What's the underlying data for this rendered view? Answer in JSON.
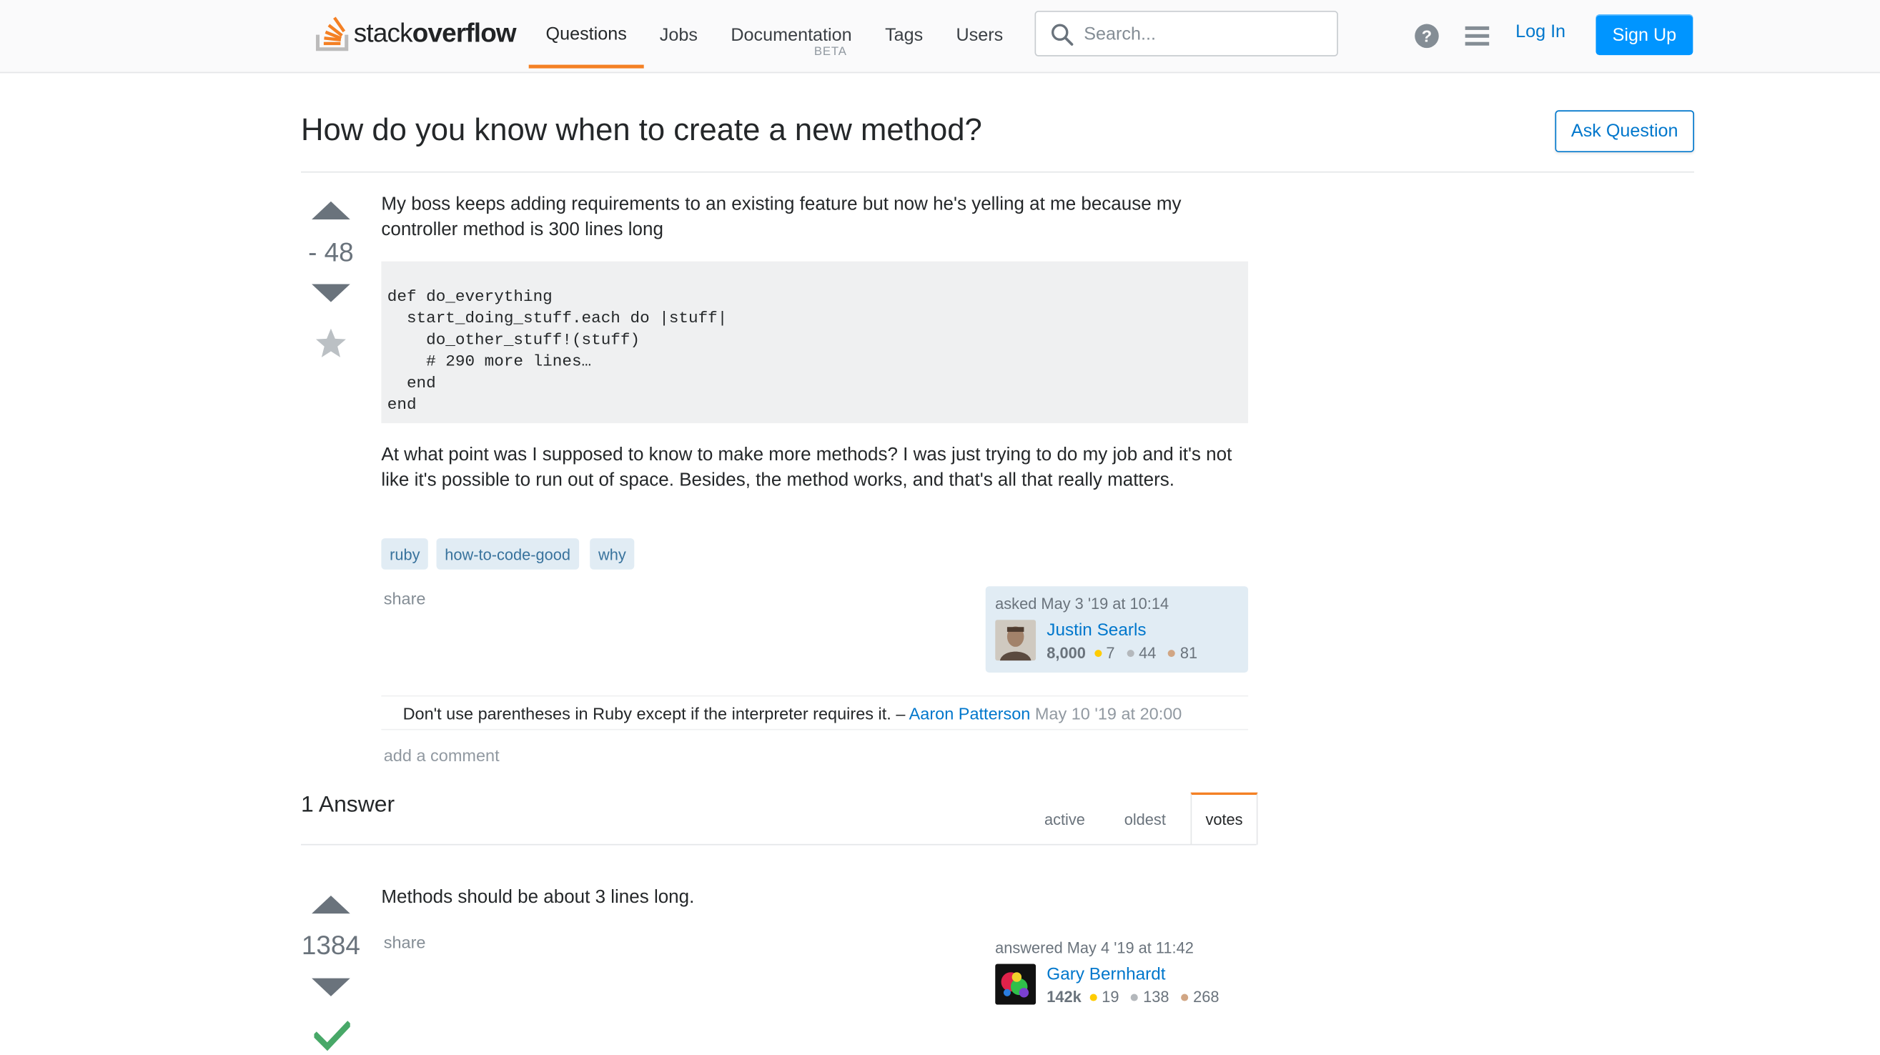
{
  "header": {
    "logo": {
      "light": "stack",
      "bold": "overflow"
    },
    "nav": [
      {
        "label": "Questions",
        "active": true
      },
      {
        "label": "Jobs",
        "active": false
      },
      {
        "label": "Documentation",
        "badge": "BETA",
        "active": false
      },
      {
        "label": "Tags",
        "active": false
      },
      {
        "label": "Users",
        "active": false
      }
    ],
    "search_placeholder": "Search...",
    "help_icon": "question-circle-icon",
    "menu_icon": "hamburger-menu-icon",
    "login_label": "Log In",
    "signup_label": "Sign Up",
    "accent_color": "#f48024",
    "primary_color": "#0095ff"
  },
  "question": {
    "title": "How do you know when to create a new method?",
    "ask_button": "Ask Question",
    "votes": "- 48",
    "intro": "My boss keeps adding requirements to an existing feature but now he's yelling at me because my controller method is 300 lines long",
    "code": [
      "def do_everything",
      "  start_doing_stuff.each do |stuff|",
      "    do_other_stuff!(stuff)",
      "    # 290 more lines…",
      "  end",
      "end"
    ],
    "body": "At what point was I supposed to know to make more methods? I was just trying to do my job and it's not like it's possible to run out of space. Besides, the method works, and that's all that really matters.",
    "tags": [
      "ruby",
      "how-to-code-good",
      "why"
    ],
    "share_label": "share",
    "owner": {
      "action_time": "asked May 3 '19 at 10:14",
      "name": "Justin Searls",
      "reputation": "8,000",
      "gold": "7",
      "silver": "44",
      "bronze": "81"
    },
    "comment": {
      "text": "Don't use parentheses in Ruby except if the interpreter requires it. – ",
      "author": "Aaron Patterson",
      "date": " May 10 '19 at 20:00"
    },
    "add_comment_label": "add a comment"
  },
  "answers": {
    "header": "1 Answer",
    "sort_tabs": [
      {
        "label": "active",
        "active": false
      },
      {
        "label": "oldest",
        "active": false
      },
      {
        "label": "votes",
        "active": true
      }
    ],
    "items": [
      {
        "votes": "1384",
        "accepted": true,
        "text": "Methods should be about 3 lines long.",
        "share_label": "share",
        "owner": {
          "action_time": "answered May 4 '19 at 11:42",
          "name": "Gary Bernhardt",
          "reputation": "142k",
          "gold": "19",
          "silver": "138",
          "bronze": "268"
        }
      }
    ]
  }
}
